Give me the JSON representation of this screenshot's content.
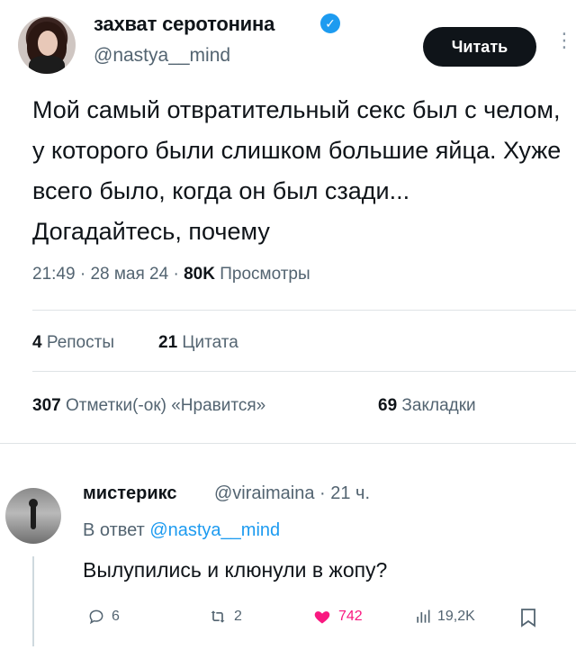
{
  "tweet": {
    "author_name": "захват серотонина",
    "author_handle": "@nastya__mind",
    "follow_label": "Читать",
    "text": "Мой самый отвратительный секс был с челом, у которого были слишком большие яйца. Хуже всего было, когда он был сзади... Догадайтесь, почему",
    "time": "21:49",
    "date": "28 мая 24",
    "views_count": "80K",
    "views_label": "Просмотры",
    "reposts_count": "4",
    "reposts_label": "Репосты",
    "quotes_count": "21",
    "quotes_label": "Цитата",
    "likes_count": "307",
    "likes_label": "Отметки(-ок) «Нравится»",
    "bookmarks_count": "69",
    "bookmarks_label": "Закладки",
    "sep": "·"
  },
  "reply": {
    "author_name": "мистерикс",
    "author_handle": "@viraimaina",
    "time_ago": "21 ч.",
    "reply_prefix": "В ответ",
    "reply_to": "@nastya__mind",
    "text": "Вылупились и клюнули в жопу?",
    "replies": "6",
    "retweets": "2",
    "likes": "742",
    "views": "19,2K"
  },
  "colors": {
    "accent": "#1d9bf0",
    "like": "#f91880",
    "button": "#0f1419"
  },
  "icons": [
    "verified-icon",
    "more-icon",
    "reply-icon",
    "retweet-icon",
    "heart-icon",
    "views-icon",
    "bookmark-icon"
  ]
}
